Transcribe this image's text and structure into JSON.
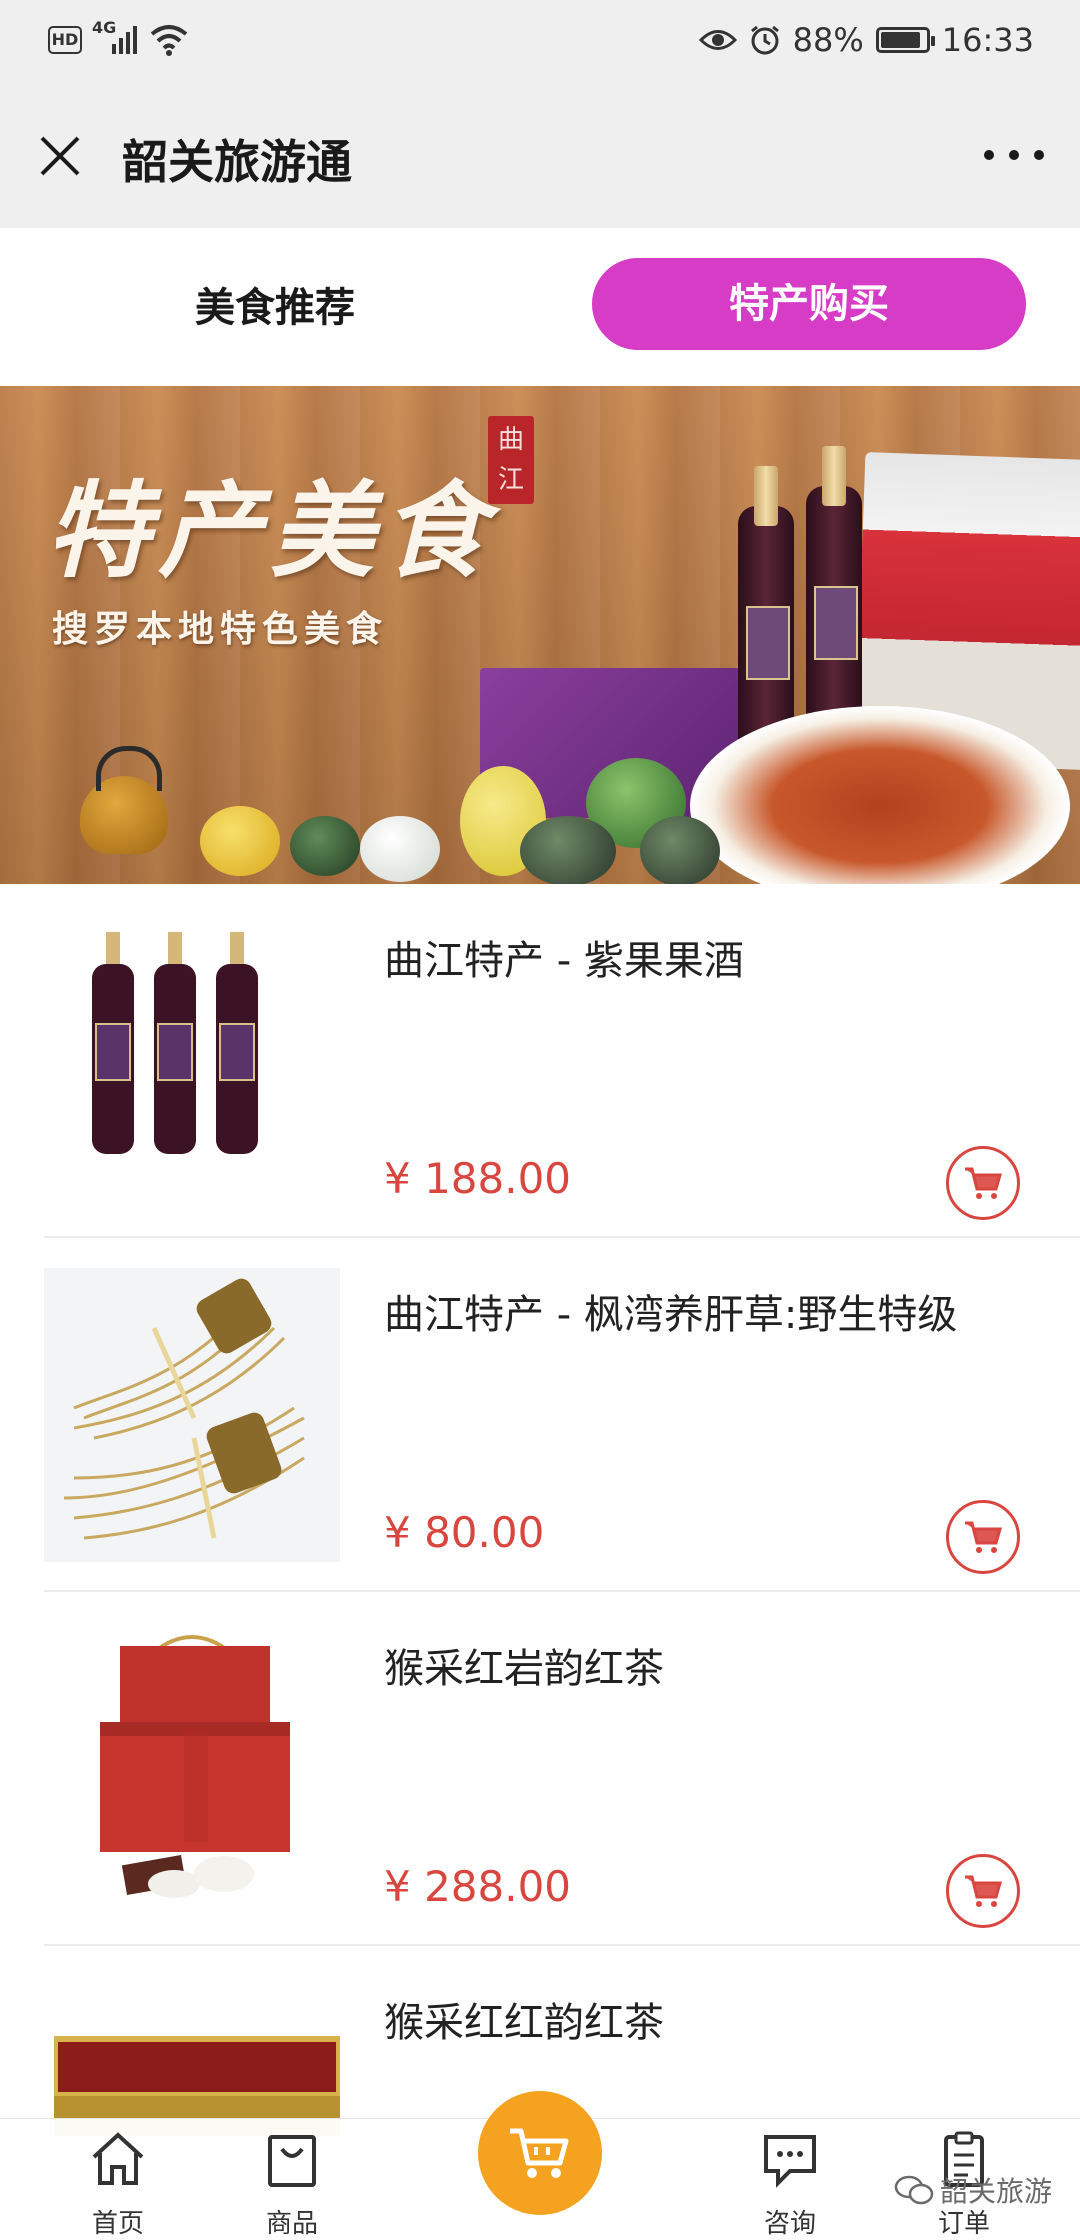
{
  "status_bar": {
    "hd_badge": "HD",
    "network": "4G",
    "battery_percent": "88%",
    "battery_level": 0.88,
    "time": "16:33"
  },
  "nav": {
    "title": "韶关旅游通"
  },
  "tabs": {
    "food_recommend": "美食推荐",
    "specialty_buy": "特产购买"
  },
  "banner": {
    "title": "特产美食",
    "subtitle": "搜罗本地特色美食",
    "seal": "曲江"
  },
  "products": [
    {
      "name": "曲江特产 - 紫果果酒",
      "price": "¥ 188.00"
    },
    {
      "name": "曲江特产 - 枫湾养肝草:野生特级",
      "price": "¥ 80.00"
    },
    {
      "name": "猴采红岩韵红茶",
      "price": "¥ 288.00"
    },
    {
      "name": "猴采红红韵红茶",
      "price": ""
    }
  ],
  "tabbar": {
    "home": "首页",
    "goods": "商品",
    "consult": "咨询",
    "orders": "订单"
  },
  "watermark": "韶关旅游",
  "colors": {
    "accent_tab": "#d63cc6",
    "price": "#d9463f",
    "cart_center": "#f4a21f"
  }
}
